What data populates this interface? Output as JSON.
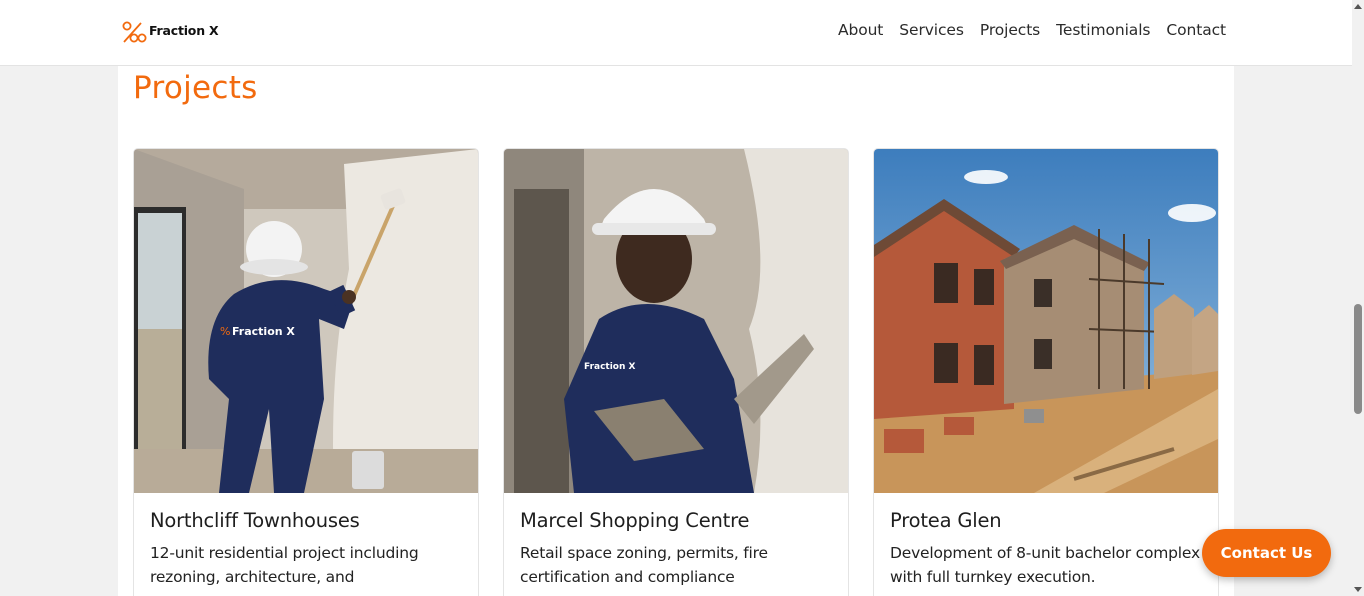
{
  "header": {
    "logo_text": "Fraction X",
    "nav": [
      "About",
      "Services",
      "Projects",
      "Testimonials",
      "Contact"
    ]
  },
  "section": {
    "title": "Projects"
  },
  "projects": [
    {
      "title": "Northcliff Townhouses",
      "description": "12-unit residential project including rezoning, architecture, and",
      "image_icon": "worker-painting-wall-image"
    },
    {
      "title": "Marcel Shopping Centre",
      "description": "Retail space zoning, permits, fire certification and compliance",
      "image_icon": "worker-plastering-wall-image"
    },
    {
      "title": "Protea Glen",
      "description": "Development of 8-unit bachelor complex with full turnkey execution.",
      "image_icon": "houses-under-construction-image"
    }
  ],
  "floating_button": {
    "label": "Contact Us"
  },
  "colors": {
    "accent": "#f26a0e",
    "workwear": "#1f2d5c",
    "background": "#f1f1f1"
  }
}
